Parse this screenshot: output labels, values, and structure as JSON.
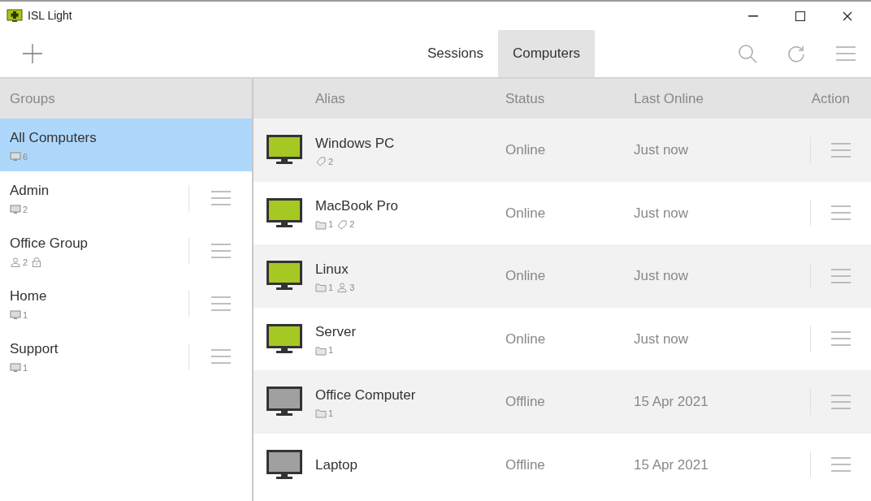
{
  "window": {
    "title": "ISL Light"
  },
  "tabs": [
    {
      "label": "Sessions",
      "selected": false
    },
    {
      "label": "Computers",
      "selected": true
    }
  ],
  "groups": {
    "heading": "Groups",
    "items": [
      {
        "name": "All Computers",
        "selected": true,
        "badges": [
          {
            "kind": "monitor",
            "count": "6"
          }
        ],
        "menu": false
      },
      {
        "name": "Admin",
        "selected": false,
        "badges": [
          {
            "kind": "monitor",
            "count": "2"
          }
        ],
        "menu": true
      },
      {
        "name": "Office Group",
        "selected": false,
        "badges": [
          {
            "kind": "user",
            "count": "2"
          },
          {
            "kind": "lock"
          }
        ],
        "menu": true
      },
      {
        "name": "Home",
        "selected": false,
        "badges": [
          {
            "kind": "monitor",
            "count": "1"
          }
        ],
        "menu": true
      },
      {
        "name": "Support",
        "selected": false,
        "badges": [
          {
            "kind": "monitor",
            "count": "1"
          }
        ],
        "menu": true
      }
    ]
  },
  "table": {
    "columns": [
      "Alias",
      "Status",
      "Last Online",
      "Action"
    ],
    "rows": [
      {
        "alias": "Windows PC",
        "online": true,
        "status": "Online",
        "last_online": "Just now",
        "badges": [
          {
            "kind": "tag",
            "count": "2"
          }
        ]
      },
      {
        "alias": "MacBook Pro",
        "online": true,
        "status": "Online",
        "last_online": "Just now",
        "badges": [
          {
            "kind": "folder",
            "count": "1"
          },
          {
            "kind": "tag",
            "count": "2"
          }
        ]
      },
      {
        "alias": "Linux",
        "online": true,
        "status": "Online",
        "last_online": "Just now",
        "badges": [
          {
            "kind": "folder",
            "count": "1"
          },
          {
            "kind": "user",
            "count": "3"
          }
        ]
      },
      {
        "alias": "Server",
        "online": true,
        "status": "Online",
        "last_online": "Just now",
        "badges": [
          {
            "kind": "folder",
            "count": "1"
          }
        ]
      },
      {
        "alias": "Office Computer",
        "online": false,
        "status": "Offline",
        "last_online": "15 Apr 2021",
        "badges": [
          {
            "kind": "folder",
            "count": "1"
          }
        ]
      },
      {
        "alias": "Laptop",
        "online": false,
        "status": "Offline",
        "last_online": "15 Apr 2021",
        "badges": []
      }
    ]
  }
}
